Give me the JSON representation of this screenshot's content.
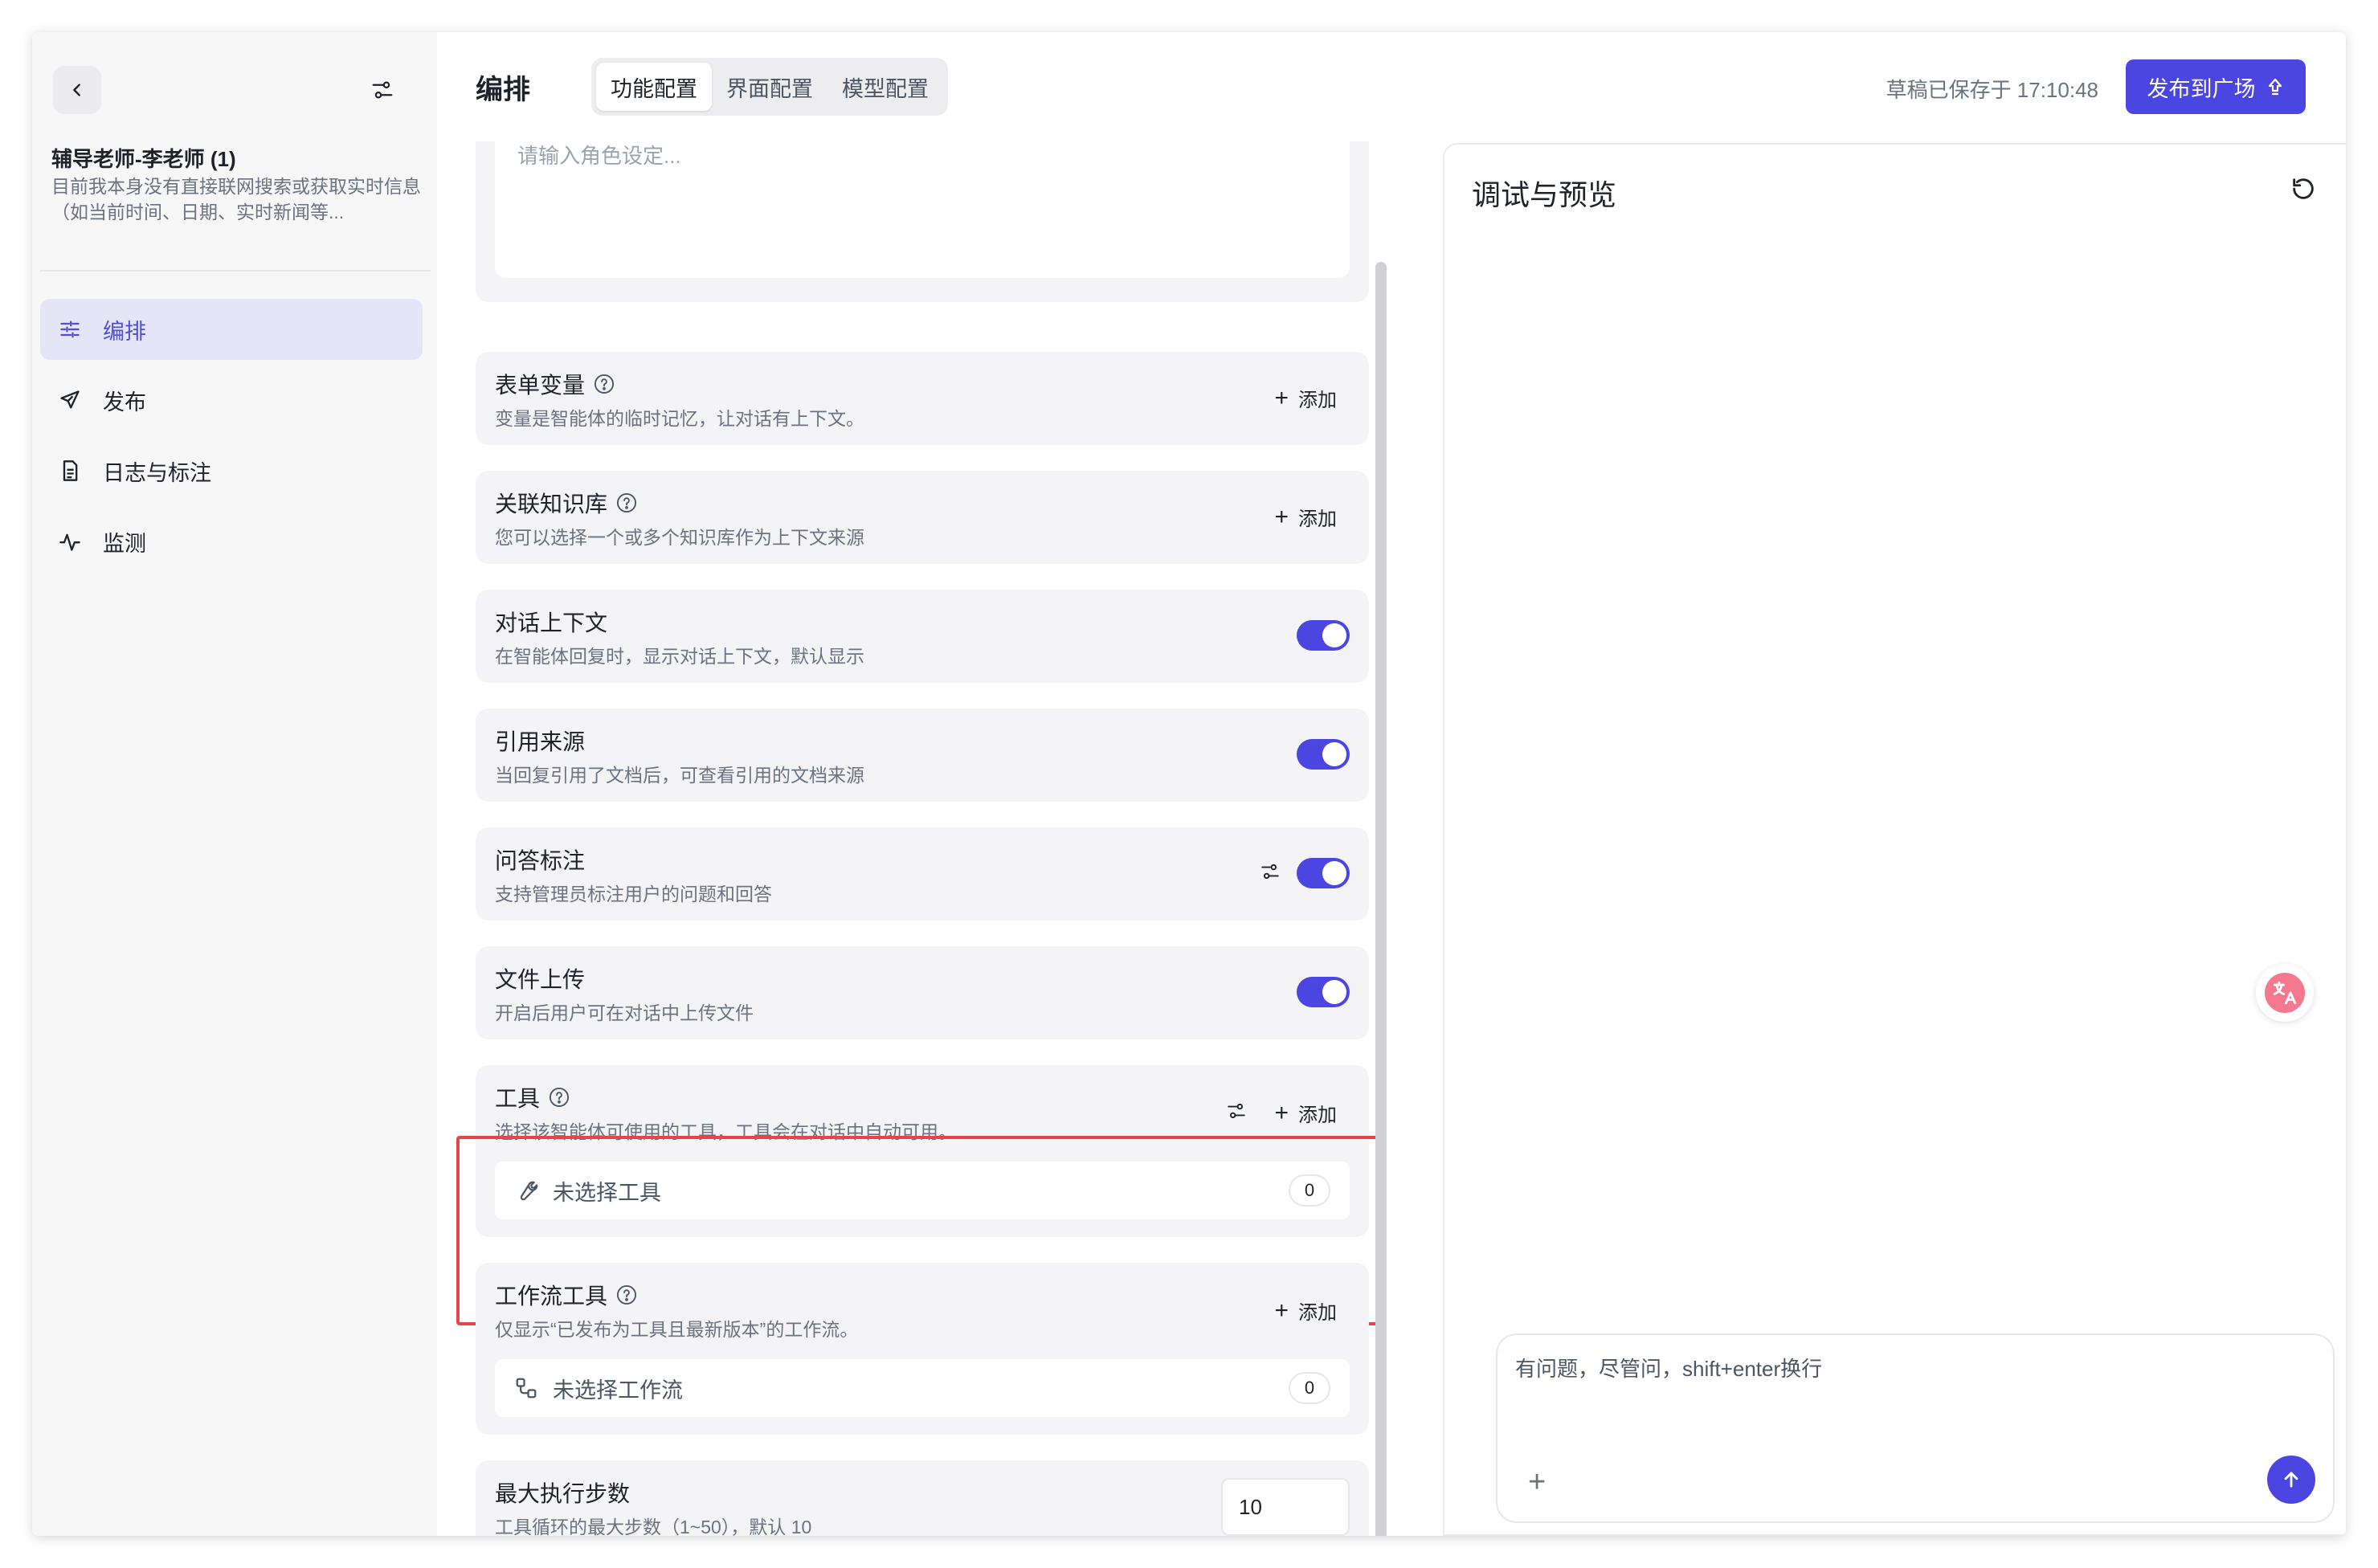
{
  "sidebar": {
    "agent_name": "辅导老师-李老师 (1)",
    "agent_desc": "目前我本身没有直接联网搜索或获取实时信息（如当前时间、日期、实时新闻等...",
    "items": [
      {
        "label": "编排",
        "icon": "sliders-icon",
        "active": true
      },
      {
        "label": "发布",
        "icon": "send-icon"
      },
      {
        "label": "日志与标注",
        "icon": "document-icon"
      },
      {
        "label": "监测",
        "icon": "activity-icon"
      }
    ]
  },
  "header": {
    "title": "编排",
    "tabs": [
      "功能配置",
      "界面配置",
      "模型配置"
    ],
    "saved_status": "草稿已保存于 17:10:48",
    "publish_label": "发布到广场"
  },
  "config": {
    "prompt_placeholder": "请输入角色设定...",
    "form_vars": {
      "title": "表单变量",
      "desc": "变量是智能体的临时记忆，让对话有上下文。",
      "add": "添加"
    },
    "knowledge": {
      "title": "关联知识库",
      "desc": "您可以选择一个或多个知识库作为上下文来源",
      "add": "添加"
    },
    "context": {
      "title": "对话上下文",
      "desc": "在智能体回复时，显示对话上下文，默认显示",
      "enabled": true
    },
    "citation": {
      "title": "引用来源",
      "desc": "当回复引用了文档后，可查看引用的文档来源",
      "enabled": true
    },
    "qa_annotation": {
      "title": "问答标注",
      "desc": "支持管理员标注用户的问题和回答",
      "enabled": true
    },
    "file_upload": {
      "title": "文件上传",
      "desc": "开启后用户可在对话中上传文件",
      "enabled": true
    },
    "tools": {
      "title": "工具",
      "desc": "选择该智能体可使用的工具，工具会在对话中自动可用。",
      "add": "添加",
      "empty": "未选择工具",
      "count": "0"
    },
    "workflow_tools": {
      "title": "工作流工具",
      "desc": "仅显示“已发布为工具且最新版本”的工作流。",
      "add": "添加",
      "empty": "未选择工作流",
      "count": "0"
    },
    "max_steps": {
      "title": "最大执行步数",
      "desc": "工具循环的最大步数（1~50），默认 10",
      "value": "10"
    }
  },
  "preview": {
    "title": "调试与预览",
    "input_placeholder": "有问题，尽管问，shift+enter换行"
  },
  "colors": {
    "accent": "#4b45e2",
    "highlight": "#e5454b"
  }
}
